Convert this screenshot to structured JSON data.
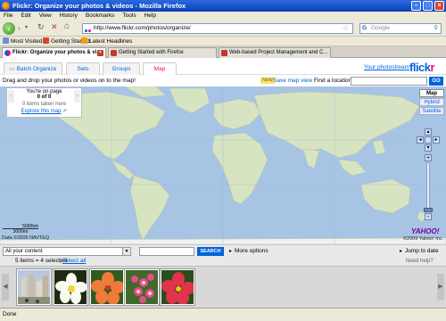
{
  "window": {
    "title": "Flickr: Organize your photos & videos - Mozilla Firefox"
  },
  "menu": [
    "File",
    "Edit",
    "View",
    "History",
    "Bookmarks",
    "Tools",
    "Help"
  ],
  "nav": {
    "url": "http://www.flickr.com/photos/organize/",
    "search_placeholder": "Google"
  },
  "bookmarks": [
    "Most Visited",
    "Getting Started",
    "Latest Headlines"
  ],
  "tabs": [
    {
      "label": "Flickr: Organize your photos & vi...",
      "active": true
    },
    {
      "label": "Getting Started with Firefox",
      "active": false
    },
    {
      "label": "Web-based Project Management and C...",
      "active": false
    }
  ],
  "flickr": {
    "tabs": [
      "Batch Organize",
      "Sets",
      "Groups",
      "Map"
    ],
    "photostream": "Your photostream",
    "logo_blue": "flick",
    "logo_pink": "r"
  },
  "map_toolbar": {
    "instruction": "Drag and drop your photos or videos on to the map!",
    "new_badge": "NEW",
    "save_map_view": "Save map view",
    "find_location": "Find a location",
    "go": "GO"
  },
  "map": {
    "info": {
      "line1": "You're on page",
      "line2": "0 of 0",
      "items": "0 items taken here",
      "explore": "Explore this map"
    },
    "types": [
      "Map",
      "Hybrid",
      "Satellite"
    ],
    "scale_top": "5000km",
    "scale_bottom": "3000mi",
    "data_credit": "Data ©2009 NAVTEQ",
    "yahoo_logo": "YAHOO!",
    "yahoo_credit": "©2009 Yahoo! Inc."
  },
  "bottom": {
    "content_select": "All your content",
    "search_button": "SEARCH",
    "more_options": "More options",
    "jump_to_date": "Jump to date",
    "need_help": "Need help?"
  },
  "selection": {
    "count_text": "5 items = 4 selected",
    "select_all": "Select all"
  },
  "status": "Done"
}
